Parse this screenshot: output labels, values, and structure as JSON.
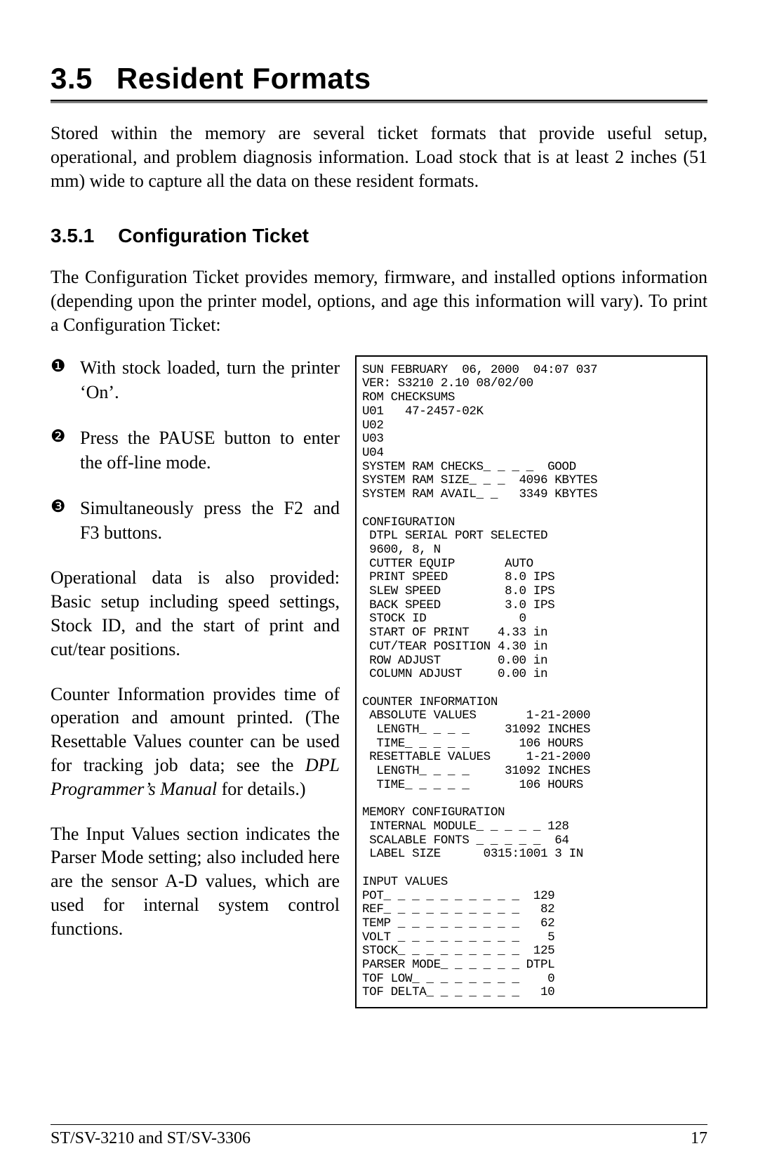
{
  "section": {
    "number": "3.5",
    "title": "Resident Formats"
  },
  "intro": "Stored within the memory are several ticket formats that provide useful setup, operational, and problem diagnosis information. Load stock that is at least 2 inches (51 mm) wide to capture all the data on these resident formats.",
  "subsection": {
    "number": "3.5.1",
    "title": "Configuration Ticket"
  },
  "subIntro": "The Configuration Ticket provides memory, firmware, and installed options information (depending upon the printer model, options, and age this information will vary). To print a Configuration Ticket:",
  "steps": [
    "With stock loaded, turn the printer ‘On’.",
    "Press the PAUSE button to enter the off-line mode.",
    "Simultaneously press the F2 and F3 buttons."
  ],
  "para1": "Operational data is also provided: Basic setup including speed settings, Stock ID, and the start of print and cut/tear positions.",
  "para2a": "Counter Information provides time of operation and amount printed. (The Resettable Values counter can be used for tracking job data; see the ",
  "para2i": "DPL Programmer’s Manual",
  "para2b": " for details.)",
  "para3": "The Input Values section indicates the Parser Mode setting; also included here are the sensor A-D values, which are used for internal system control functions.",
  "ticket": "SUN FEBRUARY  06, 2000  04:07 037\nVER: S3210 2.10 08/02/00\nROM CHECKSUMS\nU01   47-2457-02K\nU02\nU03\nU04\nSYSTEM RAM CHECKS_ _ _ _  GOOD\nSYSTEM RAM SIZE_ _ _  4096 KBYTES\nSYSTEM RAM AVAIL_ _   3349 KBYTES\n\nCONFIGURATION\n DTPL SERIAL PORT SELECTED\n 9600, 8, N\n CUTTER EQUIP       AUTO\n PRINT SPEED        8.0 IPS\n SLEW SPEED         8.0 IPS\n BACK SPEED         3.0 IPS\n STOCK ID             0\n START OF PRINT    4.33 in\n CUT/TEAR POSITION 4.30 in\n ROW ADJUST        0.00 in\n COLUMN ADJUST     0.00 in\n\nCOUNTER INFORMATION\n ABSOLUTE VALUES       1-21-2000\n  LENGTH_ _ _ _     31092 INCHES\n  TIME_ _ _ _ _       106 HOURS\n RESETTABLE VALUES     1-21-2000\n  LENGTH_ _ _ _     31092 INCHES\n  TIME_ _ _ _ _       106 HOURS\n\nMEMORY CONFIGURATION\n INTERNAL MODULE_ _ _ _ _ 128\n SCALABLE FONTS _ _ _ _ _  64\n LABEL SIZE      0315:1001 3 IN\n\nINPUT VALUES\nPOT_ _ _ _ _ _ _ _ _ _  129\nREF_ _ _ _ _ _ _ _ _ _   82\nTEMP _ _ _ _ _ _ _ _ _   62\nVOLT _ _ _ _ _ _ _ _ _    5\nSTOCK_ _ _ _ _ _ _ _ _  125\nPARSER MODE_ _ _ _ _ _ DTPL\nTOF LOW_ _ _ _ _ _ _ _    0\nTOF DELTA_ _ _ _ _ _ _   10",
  "footer": {
    "left": "ST/SV-3210 and ST/SV-3306",
    "right": "17"
  },
  "dings": [
    "❶",
    "❷",
    "❸"
  ]
}
